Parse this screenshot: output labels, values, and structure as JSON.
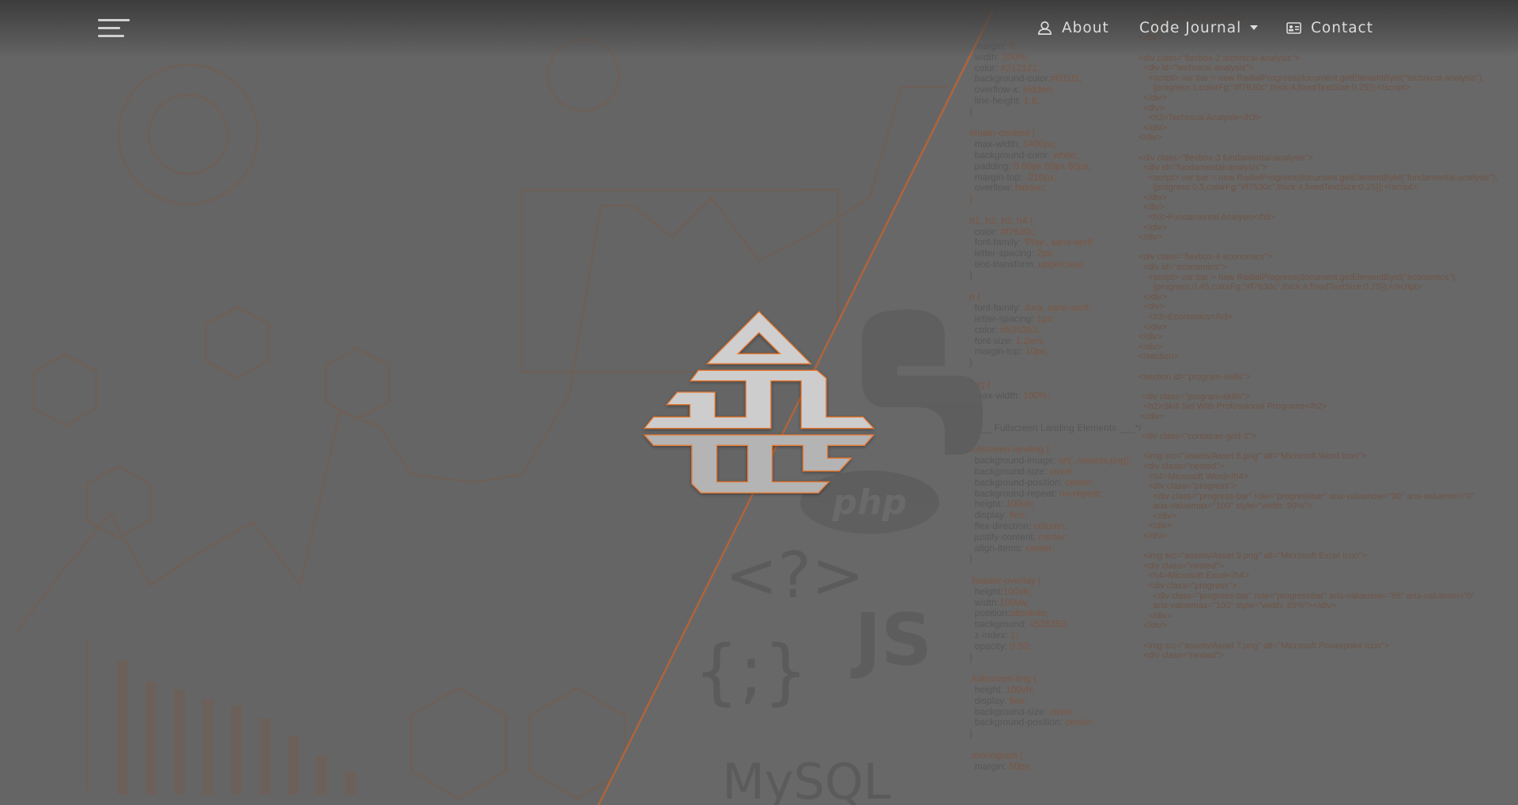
{
  "navbar": {
    "menu_icon": "hamburger-icon",
    "items": [
      {
        "label": "About",
        "icon": "user-icon"
      },
      {
        "label": "Code Journal",
        "icon": "caret-down-icon"
      },
      {
        "label": "Contact",
        "icon": "id-card-icon"
      }
    ]
  },
  "logo": {
    "fill_top": "#cfcfcf",
    "fill_bottom": "#b4b4b4",
    "outline": "#e8772e"
  },
  "colors": {
    "accent": "#f7630c",
    "background": "#686868",
    "divider": "#b0643a"
  },
  "css_code": [
    [
      "  margin: ",
      "0;"
    ],
    [
      "  width: ",
      "100%;"
    ],
    [
      "  color: ",
      "#212121;"
    ],
    [
      "  background-color:",
      "#f1f1f1;"
    ],
    [
      "  overflow-x: ",
      "hidden;"
    ],
    [
      "  line-height: ",
      "1.6;"
    ],
    [
      "}",
      ""
    ],
    [
      "",
      ""
    ],
    [
      "",
      "#main-content {"
    ],
    [
      "  max-width: ",
      "1400px;"
    ],
    [
      "  background-color: ",
      "white;"
    ],
    [
      "  padding: ",
      "0 60px 60px 60px;"
    ],
    [
      "  margin-top: ",
      "-210px;"
    ],
    [
      "  overflow: ",
      "hidden;"
    ],
    [
      "",
      "}"
    ],
    [
      "",
      ""
    ],
    [
      "",
      "h1, h2, h3, h4 {"
    ],
    [
      "  color: ",
      "#f7630c;"
    ],
    [
      "  font-family: ",
      "'Play', sans-serif;"
    ],
    [
      "  letter-spacing: ",
      "2px;"
    ],
    [
      "  text-transform: ",
      "uppercase;"
    ],
    [
      "}",
      ""
    ],
    [
      "",
      ""
    ],
    [
      "",
      "p {"
    ],
    [
      "  font-family: ",
      "Jura, sans-serif;"
    ],
    [
      "  letter-spacing: ",
      "1px;"
    ],
    [
      "  color: ",
      "#535353;"
    ],
    [
      "  font-size: ",
      "1.2em;"
    ],
    [
      "  margin-top: ",
      "10px;"
    ],
    [
      "}",
      ""
    ],
    [
      "",
      ""
    ],
    [
      "",
      "img {"
    ],
    [
      "  max-width: ",
      "100%;"
    ],
    [
      "}",
      ""
    ],
    [
      "",
      ""
    ],
    [
      "/*___ Fullscreen Landing Elements ___*/",
      ""
    ],
    [
      "",
      ""
    ],
    [
      "",
      "fullscreen-landing {"
    ],
    [
      "  background-image: ",
      "url(../assets.png);"
    ],
    [
      "  background-size: ",
      "cover;"
    ],
    [
      "  background-position: ",
      "center;"
    ],
    [
      "  background-repeat: ",
      "no-repeat;"
    ],
    [
      "  height: ",
      "100vh;"
    ],
    [
      "  display: ",
      "flex;"
    ],
    [
      "  flex-direction: ",
      "column;"
    ],
    [
      "  justify-content: ",
      "center;"
    ],
    [
      "  align-items: ",
      "center;"
    ],
    [
      "}",
      ""
    ],
    [
      "",
      ""
    ],
    [
      "",
      ".header-overlay {"
    ],
    [
      "  height:",
      "100vh;"
    ],
    [
      "  width:",
      "100vw;"
    ],
    [
      "  position:",
      "absolute;"
    ],
    [
      "  background: ",
      "#535353;"
    ],
    [
      "  z-index: ",
      "1;"
    ],
    [
      "  opacity: ",
      "0.50;"
    ],
    [
      "}",
      ""
    ],
    [
      "",
      ""
    ],
    [
      "",
      ".fullscreen-img {"
    ],
    [
      "  height: ",
      "100vh;"
    ],
    [
      "  display: ",
      "flex;"
    ],
    [
      "  background-size: ",
      "cover;"
    ],
    [
      "  background-position: ",
      "center;"
    ],
    [
      "}",
      ""
    ],
    [
      "",
      ""
    ],
    [
      "",
      ".monogram {"
    ],
    [
      "  margin: ",
      "50px;"
    ]
  ],
  "html_code": [
    "",
    "",
    "    <h3>Asset Classes</h3>",
    "  </div>",
    "</div>",
    "",
    "<div class=\"flexbox-2 technical-analysis\">",
    "  <div id=\"technical-analysis\">",
    "    <script> var bar = new RadialProgress(document.getElementById(\"technical-analysis\"),",
    "      {progress:1,colorFg:\"#f7630c\",thick:4,fixedTextSize:0.25});</script>",
    "  </div>",
    "  <div>",
    "    <h3>Technical Analysis</h3>",
    "  </div>",
    "</div>",
    "",
    "<div class=\"flexbox-3 fundamental-analysis\">",
    "  <div id=\"fundamental-analysis\">",
    "    <script> var bar = new RadialProgress(document.getElementById(\"fundamental-analysis\"),",
    "      {progress:0.5,colorFg:\"#f7630c\",thick:4,fixedTextSize:0.25});</script>",
    "  </div>",
    "  <div>",
    "    <h3>Fundamental Analysis</h3>",
    "  </div>",
    "</div>",
    "",
    "<div class=\"flexbox-4 economics\">",
    "  <div id=\"economics\">",
    "    <script> var bar = new RadialProgress(document.getElementById(\"economics\"),",
    "      {progress:0.45,colorFg:\"#f7630c\",thick:4,fixedTextSize:0.25});</script>",
    "  </div>",
    "  <div>",
    "    <h3>Economics</h3>",
    "  </div>",
    "</div>",
    "</div>",
    "</section>",
    "",
    "<section id=\"program-skills\">",
    "",
    " <div class=\"program-skills\">",
    "  <h2>Skill Set With Professional Programs</h2>",
    " </div>",
    "",
    " <div class=\"container-grid-2\">",
    "",
    "  <img src=\"assets/Asset 8.png\" alt=\"Microsoft Word Icon\">",
    "  <div class=\"nested\">",
    "    <h4>Microsoft Word</h4>",
    "    <div class=\"progress\">",
    "      <div class=\"progress-bar\" role=\"progressbar\" aria-valuenow=\"90\" aria-valuemin=\"0\"",
    "      aria-valuemax=\"100\" style=\"width: 90%\">",
    "      </div>",
    "    </div>",
    "  </div>",
    "",
    "  <img src=\"assets/Asset 9.png\" alt=\"Microsoft Excel Icon\">",
    "  <div class=\"nested\">",
    "    <h4>Microsoft Excel</h4>",
    "    <div class=\"progress\">",
    "      <div class=\"progress-bar\" role=\"progressbar\" aria-valuenow=\"85\" aria-valuemin=\"0\"",
    "      aria-valuemax=\"100\" style=\"width: 85%\"></div>",
    "    </div>",
    "  </div>",
    "",
    "  <img src=\"assets/Asset 7.png\" alt=\"Microsoft Powerpoint Icon\">",
    "  <div class=\"nested\">"
  ]
}
